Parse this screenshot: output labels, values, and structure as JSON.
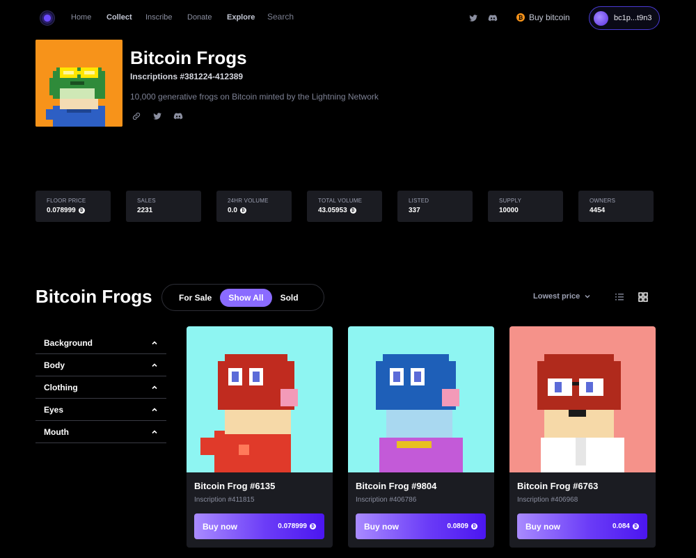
{
  "nav": {
    "links": [
      "Home",
      "Collect",
      "Inscribe",
      "Donate",
      "Explore"
    ],
    "search_placeholder": "Search",
    "buy_bitcoin": "Buy bitcoin",
    "wallet": "bc1p...t9n3"
  },
  "collection": {
    "title": "Bitcoin Frogs",
    "inscriptions": "Inscriptions #381224-412389",
    "description": "10,000 generative frogs on Bitcoin minted by the Lightning Network"
  },
  "stats": [
    {
      "label": "FLOOR PRICE",
      "value": "0.078999",
      "btc": true
    },
    {
      "label": "SALES",
      "value": "2231",
      "btc": false
    },
    {
      "label": "24HR VOLUME",
      "value": "0.0",
      "btc": true
    },
    {
      "label": "TOTAL VOLUME",
      "value": "43.05953",
      "btc": true
    },
    {
      "label": "LISTED",
      "value": "337",
      "btc": false
    },
    {
      "label": "SUPPLY",
      "value": "10000",
      "btc": false
    },
    {
      "label": "OWNERS",
      "value": "4454",
      "btc": false
    }
  ],
  "section": {
    "title": "Bitcoin Frogs",
    "toggle": [
      "For Sale",
      "Show All",
      "Sold"
    ],
    "active_toggle": "Show All",
    "sort": "Lowest price"
  },
  "filters": [
    "Background",
    "Body",
    "Clothing",
    "Eyes",
    "Mouth"
  ],
  "cards": [
    {
      "name": "Bitcoin Frog #6135",
      "inscription": "Inscription #411815",
      "buy": "Buy now",
      "price": "0.078999",
      "bg": "#8ef5f2",
      "frog": "#c02b1f",
      "clothing": "#e03a2a"
    },
    {
      "name": "Bitcoin Frog #9804",
      "inscription": "Inscription #406786",
      "buy": "Buy now",
      "price": "0.0809",
      "bg": "#8ef5f2",
      "frog": "#1e5fb8",
      "clothing": "#c35ad8"
    },
    {
      "name": "Bitcoin Frog #6763",
      "inscription": "Inscription #406968",
      "buy": "Buy now",
      "price": "0.084",
      "bg": "#f5928a",
      "frog": "#b02a1c",
      "clothing": "#ffffff"
    }
  ],
  "colors": {
    "accent": "#8a6bff",
    "btc": "#f7931a",
    "card_bg": "#1b1c22"
  }
}
